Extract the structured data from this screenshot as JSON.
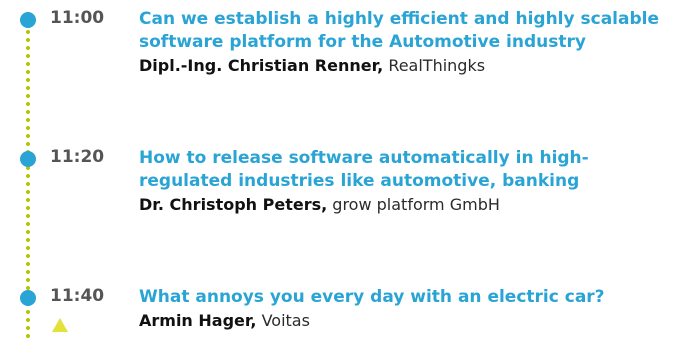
{
  "colors": {
    "accent_blue": "#2aa4d4",
    "timeline_dots": "#b8c400",
    "time_text": "#555555",
    "speaker_text": "#111111",
    "marker_yellow": "#e2e23b"
  },
  "agenda": [
    {
      "time": "11:00",
      "title": "Can we establish a highly efficient and highly scalable software platform for the Automotive industry",
      "speaker": "Dipl.-Ing. Christian Renner,",
      "company": "RealThingks"
    },
    {
      "time": "11:20",
      "title": "How to release software automatically in high-regulated industries like automotive, banking",
      "speaker": "Dr. Christoph Peters,",
      "company": "grow platform GmbH"
    },
    {
      "time": "11:40",
      "title": "What annoys you every day with an electric car?",
      "speaker": "Armin Hager,",
      "company": "Voitas"
    }
  ]
}
